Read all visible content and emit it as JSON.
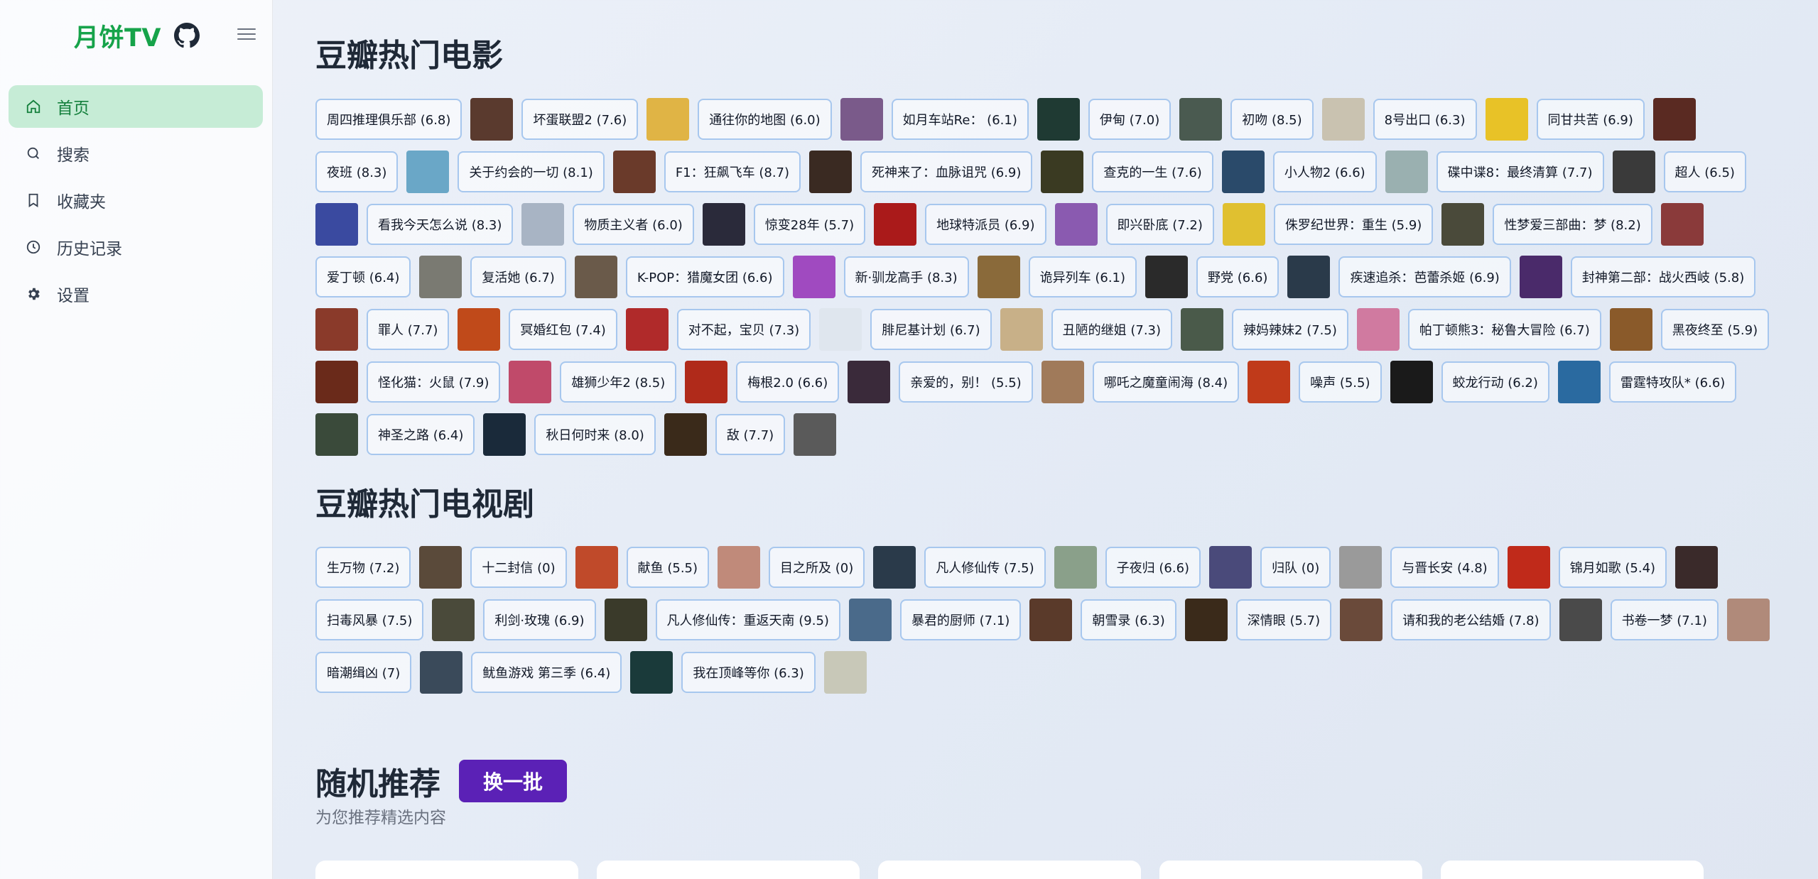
{
  "app": {
    "title": "月饼TV"
  },
  "nav": [
    {
      "label": "首页",
      "icon": "home-icon",
      "active": true
    },
    {
      "label": "搜索",
      "icon": "search-icon",
      "active": false
    },
    {
      "label": "收藏夹",
      "icon": "bookmark-icon",
      "active": false
    },
    {
      "label": "历史记录",
      "icon": "clock-icon",
      "active": false
    },
    {
      "label": "设置",
      "icon": "gear-icon",
      "active": false
    }
  ],
  "colors": {
    "accent": "#16a34a",
    "active_bg": "#c6ecd6",
    "chip_border": "#a7c7ee",
    "button": "#5b21b6"
  },
  "movies": {
    "title": "豆瓣热门电影",
    "items": [
      {
        "label": "周四推理俱乐部 (6.8)",
        "color": "#5a3a2e"
      },
      {
        "label": "坏蛋联盟2 (7.6)",
        "color": "#e0b445"
      },
      {
        "label": "通往你的地图 (6.0)",
        "color": "#7a5a8a"
      },
      {
        "label": "如月车站Re：  (6.1)",
        "color": "#1f3a33"
      },
      {
        "label": "伊甸 (7.0)",
        "color": "#4a5a50"
      },
      {
        "label": "初吻 (8.5)",
        "color": "#c9c2b0"
      },
      {
        "label": "8号出口 (6.3)",
        "color": "#e8c227"
      },
      {
        "label": "同甘共苦 (6.9)",
        "color": "#5a2a22"
      },
      {
        "label": "夜班 (8.3)",
        "color": "#6aa7c7"
      },
      {
        "label": "关于约会的一切 (8.1)",
        "color": "#6a3a2a"
      },
      {
        "label": "F1：狂飙飞车 (8.7)",
        "color": "#3a2a22"
      },
      {
        "label": "死神来了：血脉诅咒 (6.9)",
        "color": "#3a3a22"
      },
      {
        "label": "查克的一生 (7.6)",
        "color": "#2a4a6a"
      },
      {
        "label": "小人物2 (6.6)",
        "color": "#9ab0b0"
      },
      {
        "label": "碟中谍8：最终清算 (7.7)",
        "color": "#3a3a3a"
      },
      {
        "label": "超人 (6.5)",
        "color": "#3a4aa0"
      },
      {
        "label": "看我今天怎么说 (8.3)",
        "color": "#a8b4c4"
      },
      {
        "label": "物质主义者 (6.0)",
        "color": "#2a2a3a"
      },
      {
        "label": "惊变28年 (5.7)",
        "color": "#aa1a1a"
      },
      {
        "label": "地球特派员 (6.9)",
        "color": "#8a5ab0"
      },
      {
        "label": "即兴卧底 (7.2)",
        "color": "#e0c030"
      },
      {
        "label": "侏罗纪世界：重生 (5.9)",
        "color": "#4a4a3a"
      },
      {
        "label": "性梦爱三部曲：梦 (8.2)",
        "color": "#8a3a3a"
      },
      {
        "label": "爱丁顿 (6.4)",
        "color": "#7a7a72"
      },
      {
        "label": "复活她 (6.7)",
        "color": "#6a5a4a"
      },
      {
        "label": "K-POP：猎魔女团 (6.6)",
        "color": "#a04ac0"
      },
      {
        "label": "新·驯龙高手 (8.3)",
        "color": "#8a6a3a"
      },
      {
        "label": "诡异列车 (6.1)",
        "color": "#2a2a2a"
      },
      {
        "label": "野党 (6.6)",
        "color": "#2a3a4a"
      },
      {
        "label": "疾速追杀：芭蕾杀姬 (6.9)",
        "color": "#4a2a6a"
      },
      {
        "label": "封神第二部：战火西岐 (5.8)",
        "color": "#8a3a2a"
      },
      {
        "label": "罪人 (7.7)",
        "color": "#c04a1a"
      },
      {
        "label": "冥婚红包 (7.4)",
        "color": "#b02a2a"
      },
      {
        "label": "对不起，宝贝 (7.3)",
        "color": "#dfe6ee"
      },
      {
        "label": "腓尼基计划 (6.7)",
        "color": "#c8b088"
      },
      {
        "label": "丑陋的继姐 (7.3)",
        "color": "#4a5a4a"
      },
      {
        "label": "辣妈辣妹2 (7.5)",
        "color": "#d07aa0"
      },
      {
        "label": "帕丁顿熊3：秘鲁大冒险 (6.7)",
        "color": "#8a5a2a"
      },
      {
        "label": "黑夜终至 (5.9)",
        "color": "#6a2a1a"
      },
      {
        "label": "怪化猫：火鼠 (7.9)",
        "color": "#c04a6a"
      },
      {
        "label": "雄狮少年2 (8.5)",
        "color": "#b02a1a"
      },
      {
        "label": "梅根2.0 (6.6)",
        "color": "#3a2a3a"
      },
      {
        "label": "亲爱的，别！ (5.5)",
        "color": "#a07a5a"
      },
      {
        "label": "哪吒之魔童闹海 (8.4)",
        "color": "#c03a1a"
      },
      {
        "label": "噪声 (5.5)",
        "color": "#1a1a1a"
      },
      {
        "label": "蛟龙行动 (6.2)",
        "color": "#2a6aa0"
      },
      {
        "label": "雷霆特攻队* (6.6)",
        "color": "#3a4a3a"
      },
      {
        "label": "神圣之路 (6.4)",
        "color": "#1a2a3a"
      },
      {
        "label": "秋日何时来 (8.0)",
        "color": "#3a2a1a"
      },
      {
        "label": "敌 (7.7)",
        "color": "#5a5a5a"
      }
    ]
  },
  "tv": {
    "title": "豆瓣热门电视剧",
    "items": [
      {
        "label": "生万物 (7.2)",
        "color": "#5a4a3a"
      },
      {
        "label": "十二封信 (0)",
        "color": "#c04a2a"
      },
      {
        "label": "献鱼 (5.5)",
        "color": "#c08a7a"
      },
      {
        "label": "目之所及 (0)",
        "color": "#2a3a4a"
      },
      {
        "label": "凡人修仙传 (7.5)",
        "color": "#8aa08a"
      },
      {
        "label": "子夜归 (6.6)",
        "color": "#4a4a7a"
      },
      {
        "label": "归队 (0)",
        "color": "#9a9a9a"
      },
      {
        "label": "与晋长安 (4.8)",
        "color": "#c02a1a"
      },
      {
        "label": "锦月如歌 (5.4)",
        "color": "#3a2a2a"
      },
      {
        "label": "扫毒风暴 (7.5)",
        "color": "#4a4a3a"
      },
      {
        "label": "利剑·玫瑰 (6.9)",
        "color": "#3a3a2a"
      },
      {
        "label": "凡人修仙传：重返天南 (9.5)",
        "color": "#4a6a8a"
      },
      {
        "label": "暴君的厨师 (7.1)",
        "color": "#5a3a2a"
      },
      {
        "label": "朝雪录 (6.3)",
        "color": "#3a2a1a"
      },
      {
        "label": "深情眼 (5.7)",
        "color": "#6a4a3a"
      },
      {
        "label": "请和我的老公结婚 (7.8)",
        "color": "#4a4a4a"
      },
      {
        "label": "书卷一梦 (7.1)",
        "color": "#b08a7a"
      },
      {
        "label": "暗潮缉凶 (7)",
        "color": "#3a4a5a"
      },
      {
        "label": "鱿鱼游戏 第三季 (6.4)",
        "color": "#1a3a3a"
      },
      {
        "label": "我在顶峰等你 (6.3)",
        "color": "#c8c8b8"
      }
    ]
  },
  "random": {
    "title": "随机推荐",
    "refresh_label": "换一批",
    "subtitle": "为您推荐精选内容",
    "cards": [
      {
        "color": "#d05a2a"
      },
      {
        "color": "#3a8ac0"
      },
      {
        "color": "#ffffff"
      },
      {
        "color": "#111111"
      },
      {
        "color": "#b01a1a"
      }
    ]
  }
}
